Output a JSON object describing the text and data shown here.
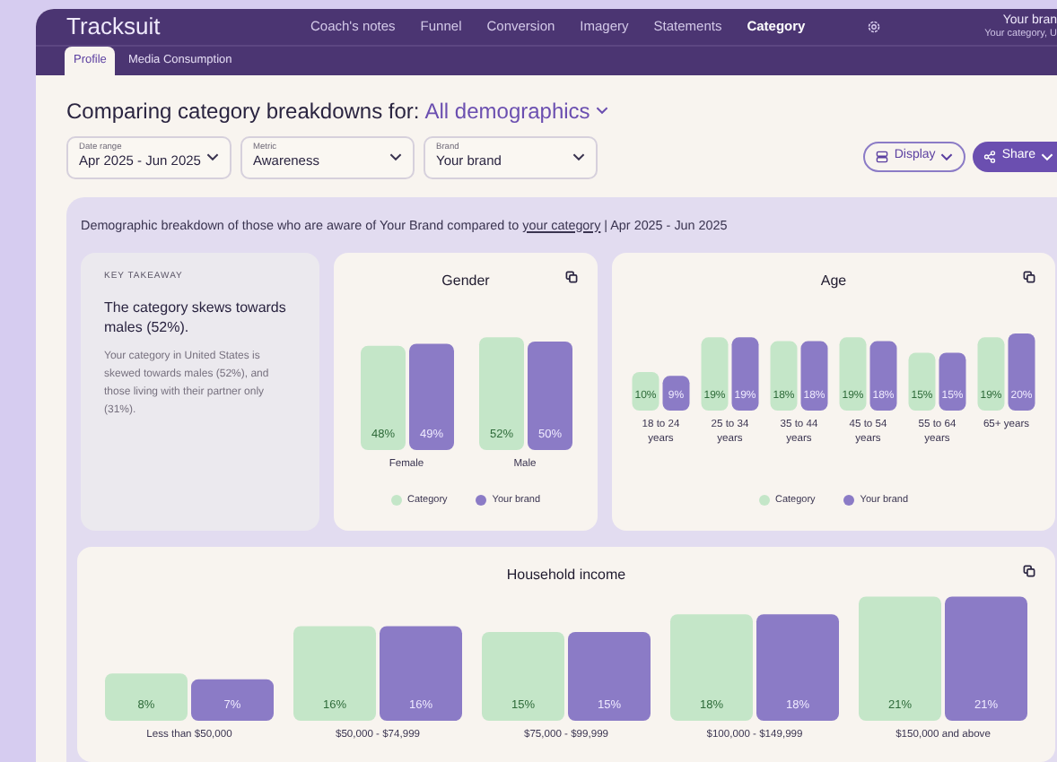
{
  "app": {
    "logo": "Tracksuit",
    "nav": [
      {
        "label": "Coach's notes",
        "selected": false
      },
      {
        "label": "Funnel",
        "selected": false
      },
      {
        "label": "Conversion",
        "selected": false
      },
      {
        "label": "Imagery",
        "selected": false
      },
      {
        "label": "Statements",
        "selected": false
      },
      {
        "label": "Category",
        "selected": true
      }
    ],
    "account": {
      "name": "Your bran",
      "subtitle": "Your category, U"
    }
  },
  "subtabs": [
    {
      "label": "Profile",
      "selected": true
    },
    {
      "label": "Media Consumption",
      "selected": false
    }
  ],
  "heading": {
    "text": "Comparing category breakdowns for:",
    "filter": "All demographics"
  },
  "filters": [
    {
      "label": "Date range",
      "value": "Apr 2025 - Jun 2025"
    },
    {
      "label": "Metric",
      "value": "Awareness"
    },
    {
      "label": "Brand",
      "value": "Your brand"
    }
  ],
  "actions": [
    {
      "label": "Display",
      "kind": "outline"
    },
    {
      "label": "Share",
      "kind": "solid"
    }
  ],
  "panel": {
    "caption": {
      "before": "Demographic breakdown of those who are aware of Your Brand compared to",
      "link": "your category",
      "after": "| Apr 2025 - Jun 2025"
    },
    "takeaway": {
      "eyebrow": "KEY TAKEAWAY",
      "headline": "The category skews towards males (52%).",
      "body": "Your category in United States is skewed towards males (52%), and those living with their partner only (31%)."
    },
    "charts": [
      {
        "chart_data": {
          "type": "bar",
          "title": "Gender",
          "categories": [
            "Female",
            "Male"
          ],
          "legend": true,
          "data_labels": true,
          "series": [
            {
              "name": "Category",
              "color": "#c4e6c8",
              "values": [
                48,
                52
              ],
              "value_labels": [
                "48%",
                "52%"
              ]
            },
            {
              "name": "Your brand",
              "color": "#8b7bc6",
              "values": [
                49,
                50
              ],
              "value_labels": [
                "49%",
                "50%"
              ]
            }
          ]
        }
      },
      {
        "chart_data": {
          "type": "bar",
          "title": "Age",
          "categories": [
            "18 to 24 years",
            "25 to 34 years",
            "35 to 44 years",
            "45 to 54 years",
            "55 to 64 years",
            "65+ years"
          ],
          "legend": true,
          "data_labels": true,
          "series": [
            {
              "name": "Category",
              "color": "#c4e6c8",
              "values": [
                10,
                19,
                18,
                19,
                15,
                19
              ],
              "value_labels": [
                "10%",
                "19%",
                "18%",
                "19%",
                "15%",
                "19%"
              ]
            },
            {
              "name": "Your brand",
              "color": "#8b7bc6",
              "values": [
                9,
                19,
                18,
                18,
                15,
                20
              ],
              "value_labels": [
                "9%",
                "19%",
                "18%",
                "18%",
                "15%",
                "20%"
              ]
            }
          ]
        }
      },
      {
        "chart_data": {
          "type": "bar",
          "title": "Household income",
          "categories": [
            "Less than $50,000",
            "$50,000 - $74,999",
            "$75,000 - $99,999",
            "$100,000 - $149,999",
            "$150,000 and above"
          ],
          "legend": false,
          "data_labels": true,
          "series": [
            {
              "color": "#c4e6c8",
              "values": [
                8,
                16,
                15,
                18,
                21
              ],
              "value_labels": [
                "8%",
                "16%",
                "15%",
                "18%",
                "21%"
              ]
            },
            {
              "color": "#8b7bc6",
              "values": [
                7,
                16,
                15,
                18,
                21
              ],
              "value_labels": [
                "7%",
                "16%",
                "15%",
                "18%",
                "21%"
              ]
            }
          ]
        }
      }
    ]
  }
}
